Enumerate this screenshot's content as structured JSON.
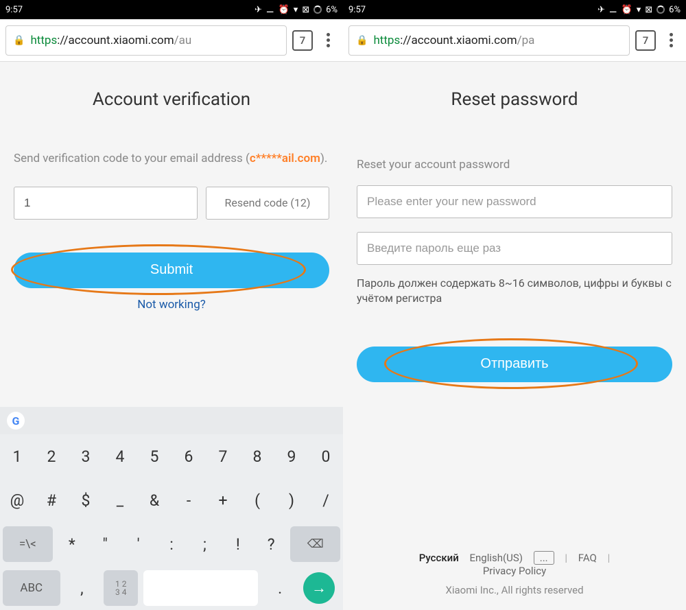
{
  "statusbar": {
    "time": "9:57",
    "battery": "6%"
  },
  "browser": {
    "tab_count": "7",
    "url_left_proto": "https",
    "url_left_host": "://account.xiaomi.com",
    "url_left_trunc": "/au",
    "url_right_proto": "https",
    "url_right_host": "://account.xiaomi.com",
    "url_right_trunc": "/pa"
  },
  "left": {
    "title": "Account verification",
    "instruction": "Send verification code to your email address (",
    "masked_email": "c*****ail.com",
    "instruction_end": ").",
    "code_value": "1",
    "resend_label": "Resend code (12)",
    "submit_label": "Submit",
    "not_working": "Not working?"
  },
  "right": {
    "title": "Reset password",
    "instruction": "Reset your account password",
    "placeholder1": "Please enter your new password",
    "placeholder2": "Введите пароль еще раз",
    "hint": "Пароль должен содержать 8~16 символов, цифры и буквы с учётом регистра",
    "submit_label": "Отправить"
  },
  "keyboard": {
    "row1": [
      "1",
      "2",
      "3",
      "4",
      "5",
      "6",
      "7",
      "8",
      "9",
      "0"
    ],
    "row2": [
      "@",
      "#",
      "$",
      "_",
      "&",
      "-",
      "+",
      "(",
      ")",
      "/"
    ],
    "row3_shift": "=\\<",
    "row3": [
      "*",
      "\"",
      "'",
      ":",
      ";",
      "!",
      "?"
    ],
    "row3_del": "⌫",
    "row4_abc": "ABC",
    "row4_comma": ",",
    "row4_nums": "1 2\n3 4",
    "row4_dot": ".",
    "row4_enter": "→"
  },
  "footer": {
    "lang_ru": "Русский",
    "lang_en": "English(US)",
    "dots": "...",
    "faq": "FAQ",
    "privacy": "Privacy Policy",
    "copyright": "Xiaomi Inc., All rights reserved"
  }
}
